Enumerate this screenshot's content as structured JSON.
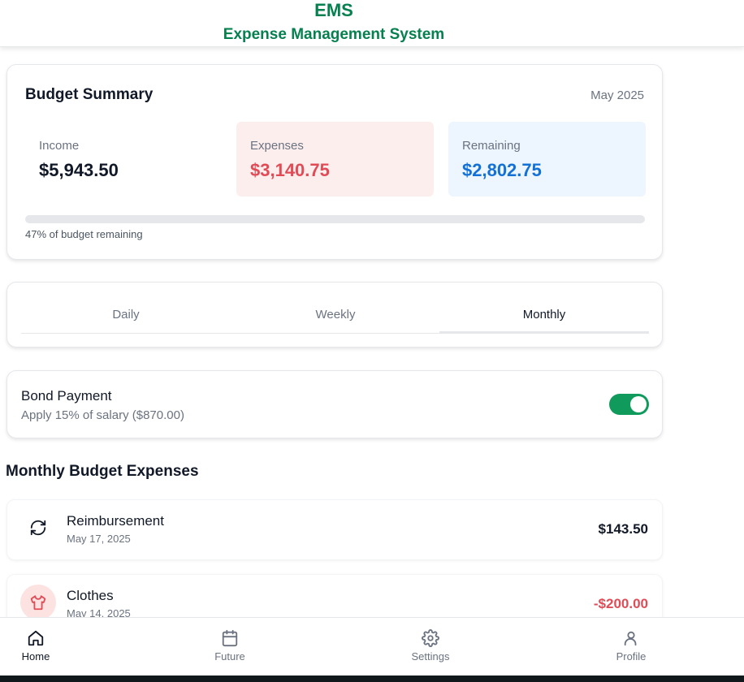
{
  "header": {
    "title": "EMS",
    "subtitle": "Expense Management System",
    "accent_color": "#07804f"
  },
  "budget": {
    "title": "Budget Summary",
    "month": "May 2025",
    "income_label": "Income",
    "income_value": "$5,943.50",
    "expenses_label": "Expenses",
    "expenses_value": "$3,140.75",
    "remaining_label": "Remaining",
    "remaining_value": "$2,802.75",
    "remaining_percent": 47,
    "progress_text": "47% of budget remaining",
    "expenses_color": "#e14b56",
    "remaining_color": "#1371d6"
  },
  "tabs": {
    "items": [
      {
        "label": "Daily"
      },
      {
        "label": "Weekly"
      },
      {
        "label": "Monthly"
      }
    ],
    "selected": "Monthly"
  },
  "bond": {
    "title": "Bond Payment",
    "subtitle": "Apply 15% of salary ($870.00)",
    "enabled": true,
    "toggle_color": "#109a5c"
  },
  "expenses_section": {
    "heading": "Monthly Budget Expenses",
    "items": [
      {
        "name": "Reimbursement",
        "date": "May 17, 2025",
        "amount": "$143.50",
        "icon": "refresh-icon"
      },
      {
        "name": "Clothes",
        "date": "May 14, 2025",
        "amount": "-$200.00",
        "icon": "shirt-icon"
      }
    ]
  },
  "nav": {
    "items": [
      {
        "label": "Home",
        "icon": "home-icon",
        "active": true
      },
      {
        "label": "Future",
        "icon": "calendar-icon"
      },
      {
        "label": "Settings",
        "icon": "gear-icon"
      },
      {
        "label": "Profile",
        "icon": "user-icon"
      }
    ]
  }
}
